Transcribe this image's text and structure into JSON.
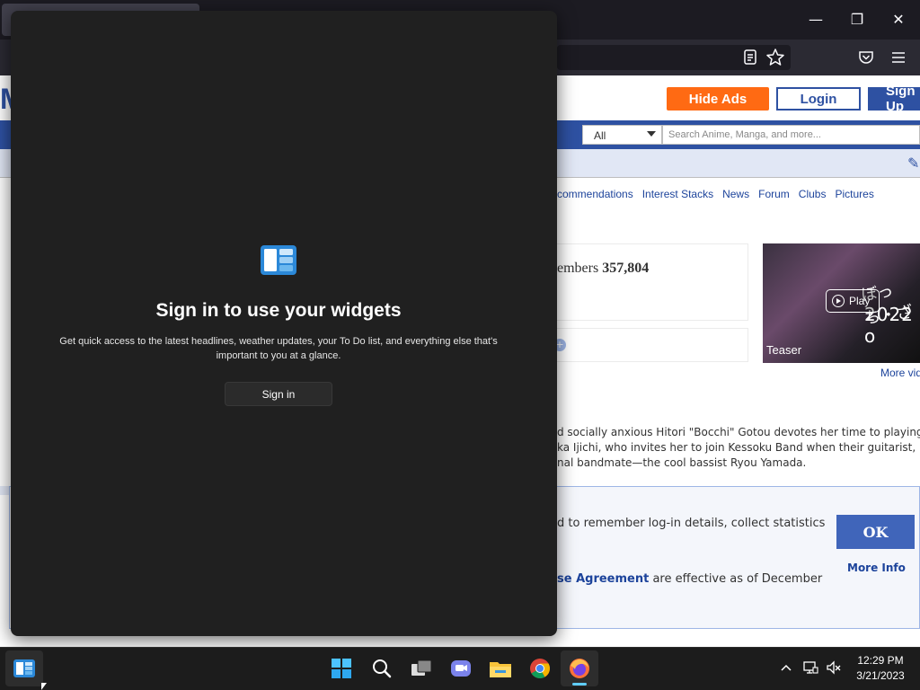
{
  "browser": {
    "window_controls": {
      "minimize": "—",
      "maximize": "❐",
      "close": "✕"
    }
  },
  "website": {
    "logo_letter": "M",
    "header_buttons": {
      "hide_ads": "Hide Ads",
      "login": "Login",
      "signup": "Sign Up"
    },
    "search": {
      "category": "All",
      "placeholder": "Search Anime, Manga, and more..."
    },
    "menu_links": [
      "commendations",
      "Interest Stacks",
      "News",
      "Forum",
      "Clubs",
      "Pictures"
    ],
    "stats": {
      "label": "embers",
      "value": "357,804"
    },
    "trailer": {
      "play_label": "Play",
      "teaser_label": "Teaser",
      "jp_text": "ぼっち・ざ",
      "year_text": "2022 o",
      "more_videos": "More vid"
    },
    "synopsis_lines": [
      "d socially anxious Hitori \"Bocchi\" Gotou devotes her time to playing the",
      "ka Ijichi, who invites her to join Kessoku Band when their guitarist, Iku",
      "nal bandmate—the cool bassist Ryou Yamada."
    ],
    "cookie_notice": {
      "line1": "d to remember log-in details, collect statistics",
      "line2_link": "se Agreement",
      "line2_rest": " are effective as of December",
      "ok_label": "OK",
      "more_info": "More Info"
    }
  },
  "widgets_panel": {
    "title": "Sign in to use your widgets",
    "description": "Get quick access to the latest headlines, weather updates, your To Do list, and everything else that's important to you at a glance.",
    "signin_label": "Sign in"
  },
  "taskbar": {
    "clock_time": "12:29 PM",
    "clock_date": "3/21/2023"
  }
}
